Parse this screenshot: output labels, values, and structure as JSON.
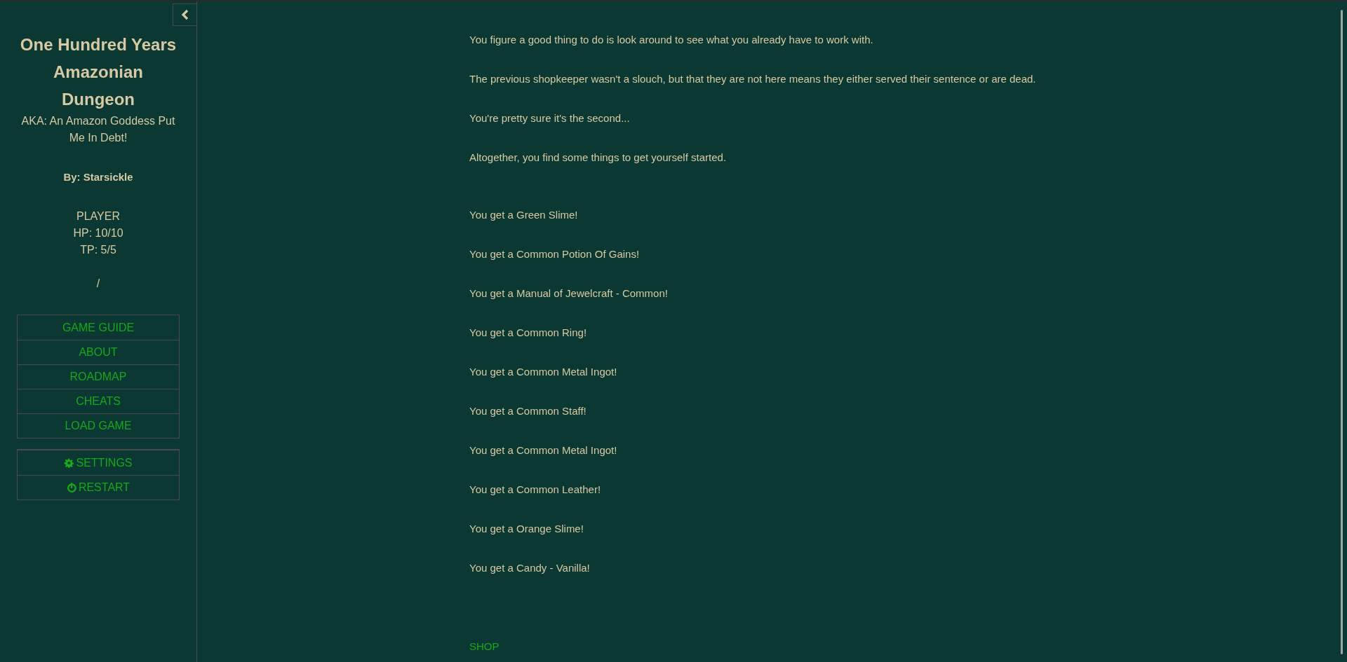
{
  "sidebar": {
    "title": "One Hundred Years Amazonian Dungeon",
    "subtitle": "AKA: An Amazon Goddess Put Me In Debt!",
    "author": "By: Starsickle",
    "stats": [
      "PLAYER",
      "HP: 10/10",
      "TP: 5/5"
    ],
    "location": "/",
    "menu": [
      "GAME GUIDE",
      "ABOUT",
      "ROADMAP",
      "CHEATS",
      "LOAD GAME"
    ],
    "actions": [
      {
        "kind": "settings",
        "label": "SETTINGS"
      },
      {
        "kind": "restart",
        "label": "RESTART"
      }
    ]
  },
  "story": {
    "paragraphs": [
      "You figure a good thing to do is look around to see what you already have to work with.",
      "The previous shopkeeper wasn't a slouch, but that they are not here means they either served their sentence or are dead.",
      "You're pretty sure it's the second...",
      "Altogether, you find some things to get yourself started."
    ],
    "items": [
      "You get a Green Slime!",
      "You get a Common Potion Of Gains!",
      "You get a Manual of Jewelcraft - Common!",
      "You get a Common Ring!",
      "You get a Common Metal Ingot!",
      "You get a Common Staff!",
      "You get a Common Metal Ingot!",
      "You get a Common Leather!",
      "You get a Orange Slime!",
      "You get a Candy - Vanilla!"
    ],
    "link": "SHOP"
  }
}
